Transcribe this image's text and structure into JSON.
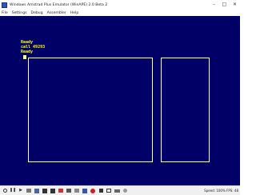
{
  "window": {
    "title": "Windows Amstrad Plus Emulator (WinAPE) 2.0 Beta 2"
  },
  "menu": {
    "items": [
      "File",
      "Settings",
      "Debug",
      "Assembler",
      "Help"
    ]
  },
  "screen": {
    "lines": [
      "Ready",
      "call 49293",
      "Ready"
    ],
    "colors": {
      "background": "#000066",
      "text": "#ffff00",
      "border": "#ffffff"
    }
  },
  "statusbar": {
    "icons": [
      "power-icon",
      "pause-icon",
      "play-icon",
      "snapshot-icon",
      "save-icon",
      "drive-a-icon",
      "drive-b-icon",
      "tape-icon",
      "joystick-icon",
      "printer-icon",
      "disk-icon",
      "record-icon",
      "stop-icon",
      "fullscreen-icon",
      "keyboard-icon",
      "settings-icon"
    ],
    "speed": "Speed: 100%  FPS: 48"
  }
}
